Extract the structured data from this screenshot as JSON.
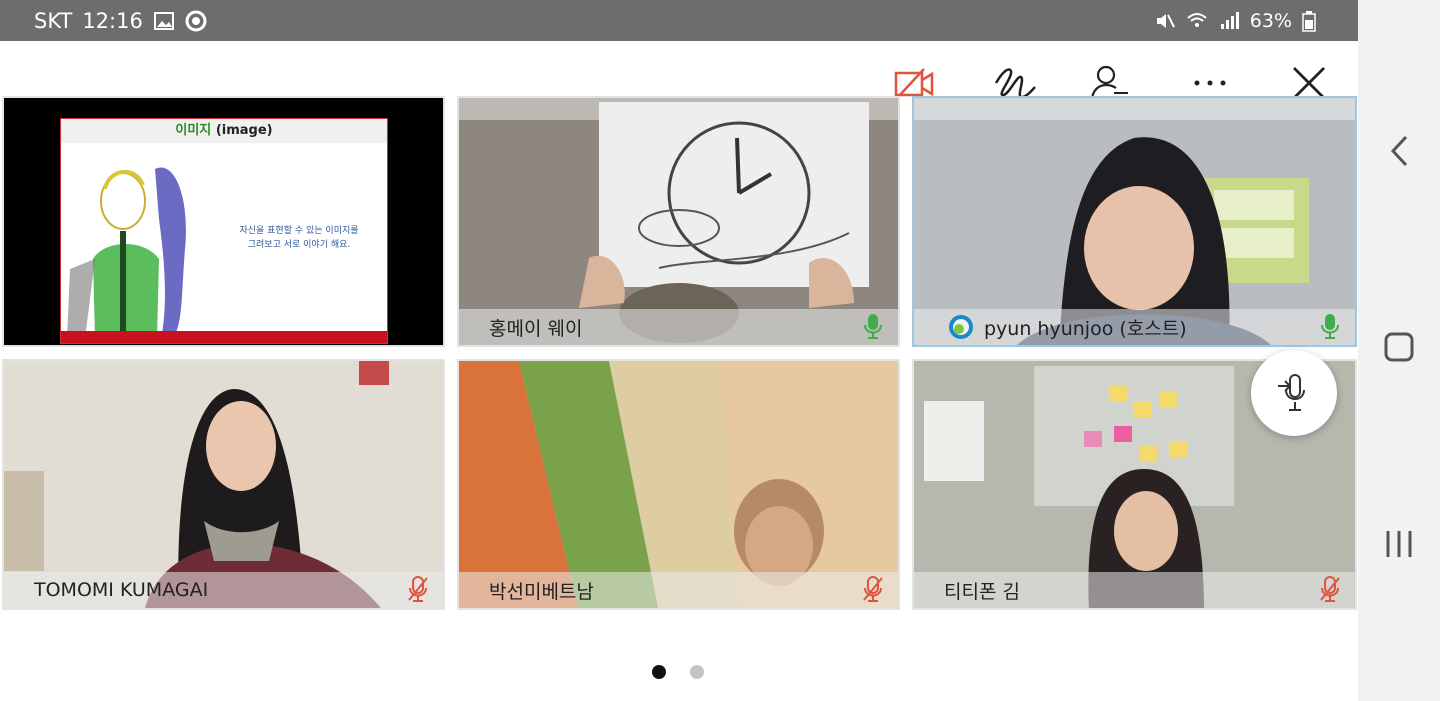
{
  "status_bar": {
    "carrier": "SKT",
    "time": "12:16",
    "battery": "63%"
  },
  "toolbar": {
    "icons": [
      "video-off-icon",
      "annotate-icon",
      "participants-icon",
      "more-icon",
      "close-icon"
    ]
  },
  "tiles": [
    {
      "type": "slide",
      "slide_title_ko": "이미지",
      "slide_title_en": "(image)",
      "slide_text_line1": "자신을 표현할 수 있는 이미지를",
      "slide_text_line2": "그려보고 서로 이야기 해요."
    },
    {
      "type": "video",
      "name": "홍메이 웨이",
      "mic": "on"
    },
    {
      "type": "video",
      "name": "pyun hyunjoo (호스트)",
      "mic": "on",
      "active": true
    },
    {
      "type": "video",
      "name": "TOMOMI KUMAGAI",
      "mic": "muted"
    },
    {
      "type": "video",
      "name": "박선미베트남",
      "mic": "muted"
    },
    {
      "type": "video",
      "name": "티티폰 김",
      "mic": "muted"
    }
  ],
  "pagination": {
    "total": 2,
    "current": 1
  },
  "colors": {
    "mic_on": "#3fae49",
    "mic_muted": "#e0533c",
    "dot_active": "#111111",
    "dot_inactive": "#c4c4c4",
    "video_off": "#e0533c"
  }
}
